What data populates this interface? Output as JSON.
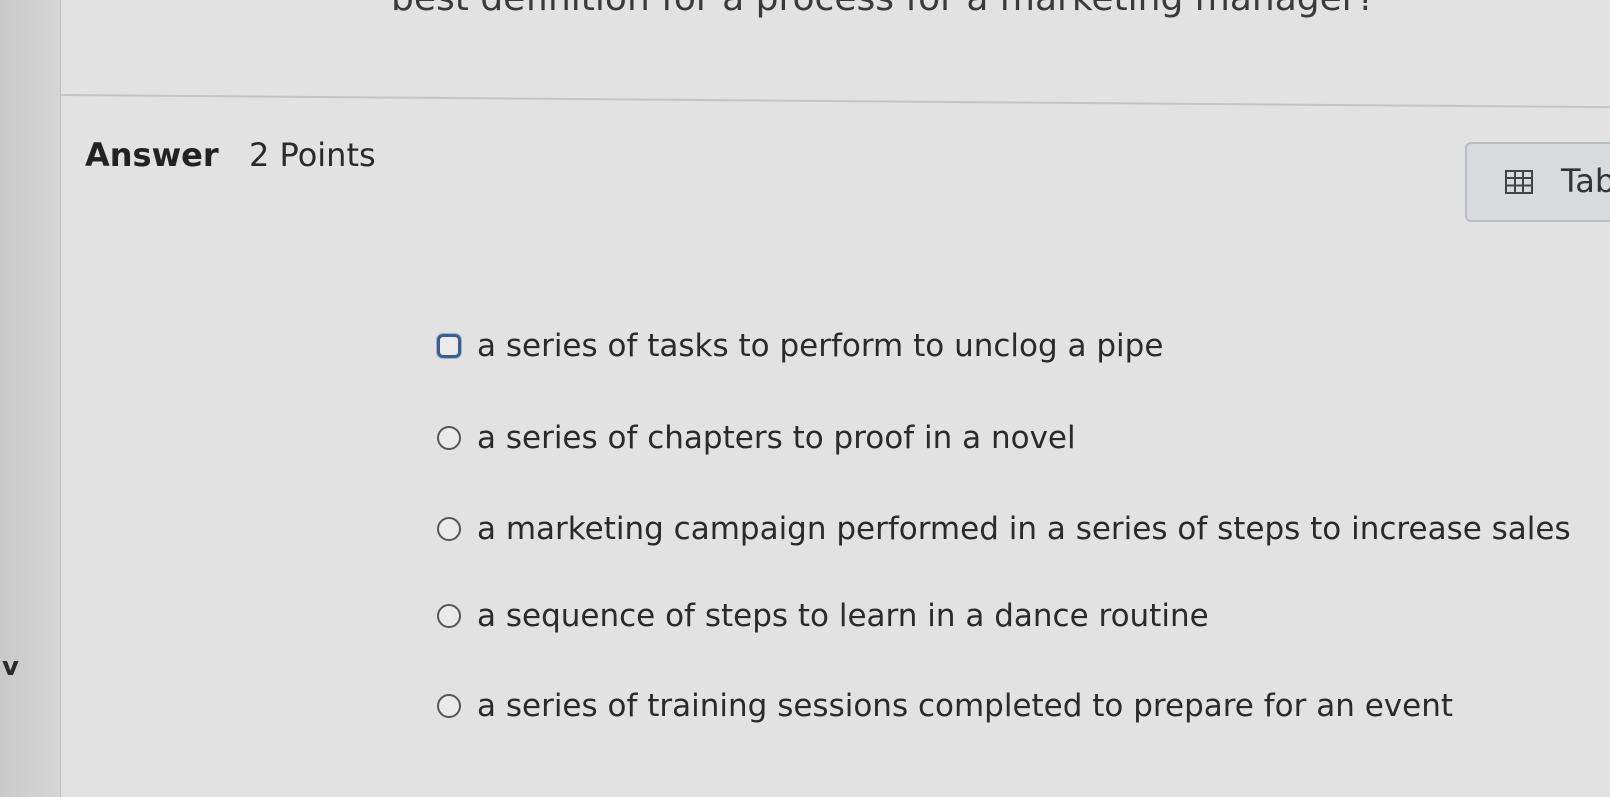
{
  "question": {
    "partial_text": "best definition for a process for a marketing manager?"
  },
  "answer": {
    "label": "Answer",
    "points": "2 Points"
  },
  "table_button": {
    "label": "Tab",
    "icon": "table-icon"
  },
  "left_strip": {
    "letter": "v"
  },
  "options": [
    {
      "text": "a series of tasks to perform to unclog a pipe",
      "focused": true
    },
    {
      "text": "a series of chapters to proof in a novel",
      "focused": false
    },
    {
      "text": "a marketing campaign performed in a series of steps to increase sales",
      "focused": false
    },
    {
      "text": "a sequence of steps to learn in a dance routine",
      "focused": false
    },
    {
      "text": "a series of training sessions completed to prepare for an event",
      "focused": false
    }
  ]
}
